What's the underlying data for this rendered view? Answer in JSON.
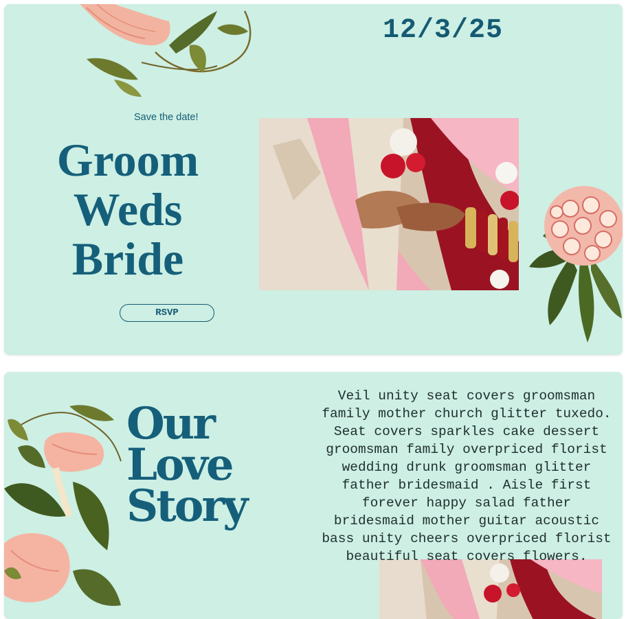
{
  "hero": {
    "date": "12/3/25",
    "tagline": "Save the date!",
    "title_lines": [
      "Groom",
      "Weds",
      "Bride"
    ],
    "rsvp_label": "RSVP"
  },
  "story": {
    "title_lines": [
      "Our",
      "Love",
      "Story"
    ],
    "body": "Veil unity seat covers groomsman family mother church glitter tuxedo. Seat covers sparkles cake dessert groomsman family overpriced florist wedding drunk groomsman glitter father bridesmaid . Aisle first forever happy salad father bridesmaid mother guitar acoustic bass unity cheers overpriced florist beautiful seat covers flowers."
  },
  "colors": {
    "background": "#cdefe4",
    "accent": "#155f7a"
  },
  "icons": [
    "floral-vine-decoration",
    "protea-flower-decoration",
    "morning-glory-decoration"
  ]
}
